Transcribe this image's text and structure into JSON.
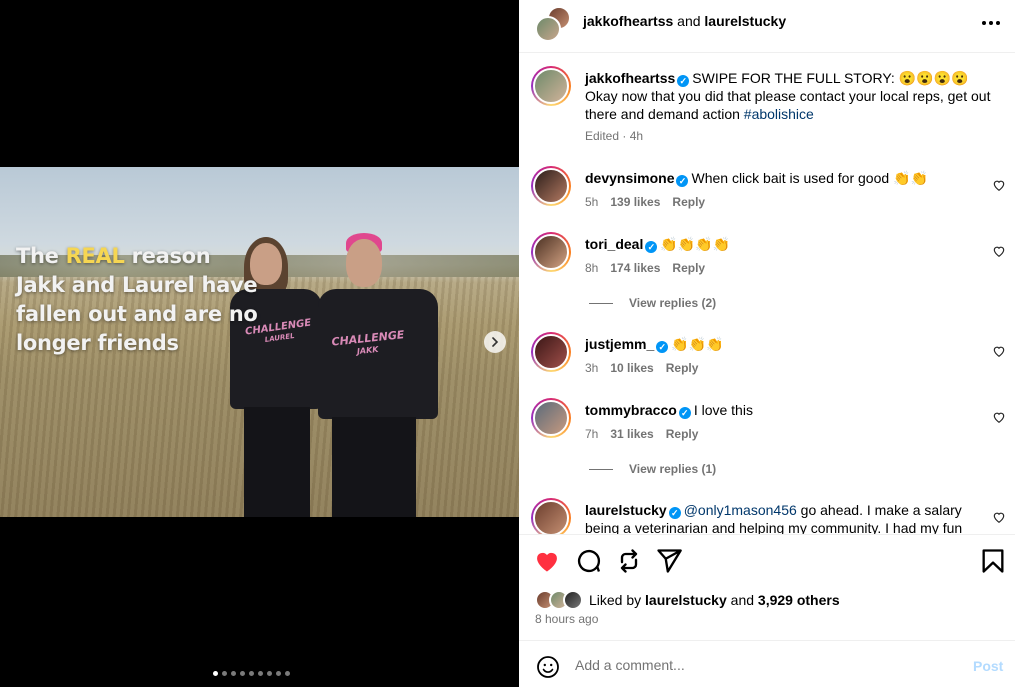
{
  "media": {
    "overlay_line1_pre": "The ",
    "overlay_highlight": "REAL",
    "overlay_line1_post": " reason Jakk and Laurel have fallen out and are no longer friends",
    "shirt_woman_brand": "CHALLENGE",
    "shirt_woman_name": "LAUREL",
    "shirt_man_brand": "CHALLENGE",
    "shirt_man_name": "JAKK",
    "next_icon": "chevron-right-icon",
    "dots_total": 9,
    "dots_active": 1
  },
  "header": {
    "user1": "jakkofheartss",
    "and": " and ",
    "user2": "laurelstucky",
    "more_icon": "more-horizontal-icon"
  },
  "caption": {
    "username": "jakkofheartss",
    "verified": "✓",
    "text_pre": "SWIPE FOR THE FULL STORY: 😮😮😮😮 Okay now that you did that please contact your local reps, get out there and demand action ",
    "hashtag": "#abolishice",
    "meta": "Edited · 4h"
  },
  "comments": [
    {
      "username": "devynsimone",
      "verified": true,
      "text": "When click bait is used for good 👏👏",
      "time": "5h",
      "likes": "139 likes",
      "reply": "Reply"
    },
    {
      "username": "tori_deal",
      "verified": true,
      "text": "👏👏👏👏",
      "time": "8h",
      "likes": "174 likes",
      "reply": "Reply",
      "view_replies": "View replies (2)"
    },
    {
      "username": "justjemm_",
      "verified": true,
      "text": "👏👏👏",
      "time": "3h",
      "likes": "10 likes",
      "reply": "Reply"
    },
    {
      "username": "tommybracco",
      "verified": true,
      "text": "I love this",
      "time": "7h",
      "likes": "31 likes",
      "reply": "Reply",
      "view_replies": "View replies (1)"
    },
    {
      "username": "laurelstucky",
      "verified": true,
      "mention": "@only1mason456",
      "text": " go ahead. I make a salary being a veterinarian and helping my community. I had my fun"
    }
  ],
  "actions": {
    "like_icon": "heart-filled-icon",
    "comment_icon": "comment-icon",
    "repost_icon": "repost-icon",
    "share_icon": "send-icon",
    "save_icon": "bookmark-icon",
    "liked_by_prefix": "Liked by ",
    "liked_by_user": "laurelstucky",
    "liked_by_mid": " and ",
    "liked_by_count": "3,929 others",
    "time_ago": "8 hours ago"
  },
  "comment_bar": {
    "placeholder": "Add a comment...",
    "post_label": "Post",
    "emoji_icon": "smiley-icon"
  },
  "colors": {
    "like_red": "#ff3040",
    "link_blue": "#00376b",
    "verified_blue": "#0095f6",
    "post_disabled": "#b3dbff"
  }
}
